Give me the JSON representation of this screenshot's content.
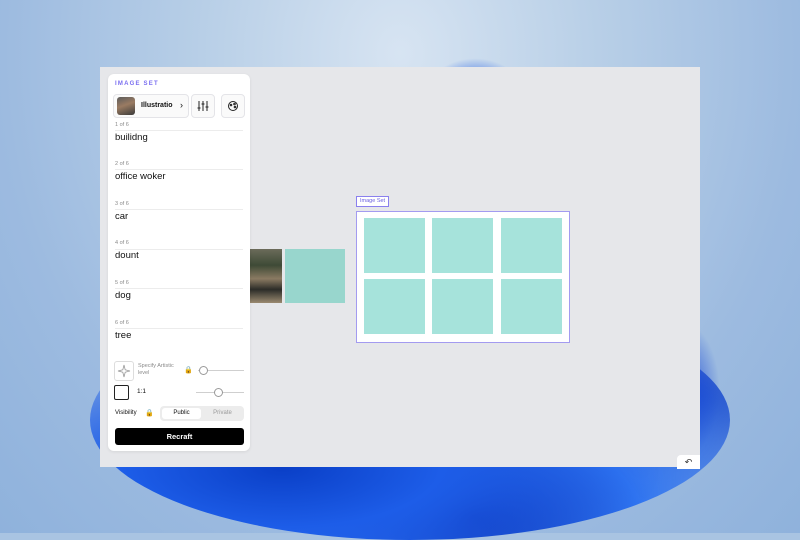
{
  "panel": {
    "title": "IMAGE SET",
    "style_label": "Illustratio",
    "prompts": [
      {
        "count": "1 of 6",
        "text": "builidng"
      },
      {
        "count": "2 of 6",
        "text": "office woker"
      },
      {
        "count": "3 of 6",
        "text": "car"
      },
      {
        "count": "4 of 6",
        "text": "dount"
      },
      {
        "count": "5 of 6",
        "text": "dog"
      },
      {
        "count": "6 of 6",
        "text": "tree"
      }
    ],
    "artistic_label": "Specify Artistic level",
    "ratio_label": "1:1",
    "visibility_label": "Visibility",
    "visibility_public": "Public",
    "visibility_private": "Private",
    "recraft_label": "Recraft"
  },
  "canvas": {
    "set_tag": "Image Set"
  },
  "colors": {
    "accent": "#7a6ef0",
    "cell": "#a6e3db",
    "button": "#000000"
  }
}
